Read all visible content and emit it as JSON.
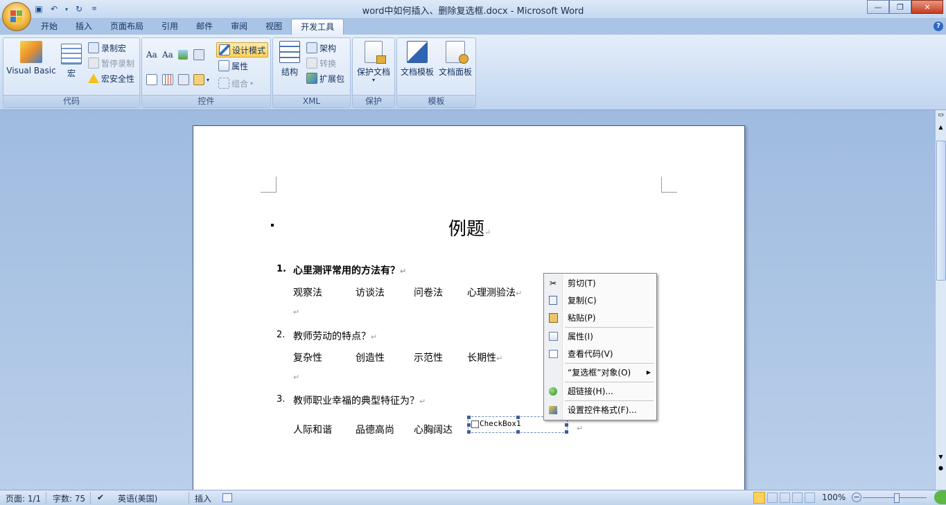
{
  "window": {
    "title": "word中如何插入、删除复选框.docx - Microsoft Word"
  },
  "tabs": [
    "开始",
    "插入",
    "页面布局",
    "引用",
    "邮件",
    "审阅",
    "视图",
    "开发工具"
  ],
  "ribbon": {
    "code": {
      "caption": "代码",
      "visual_basic": "Visual Basic",
      "macro": "宏",
      "record_macro": "录制宏",
      "pause_record": "暂停录制",
      "macro_security": "宏安全性"
    },
    "controls": {
      "caption": "控件",
      "aa1": "Aa",
      "aa2": "Aa",
      "design_mode": "设计模式",
      "properties": "属性",
      "group": "组合"
    },
    "xml": {
      "caption": "XML",
      "structure": "结构",
      "schema": "架构",
      "transform": "转换",
      "expansion_pack": "扩展包"
    },
    "protect": {
      "caption": "保护",
      "protect_doc": "保护文档"
    },
    "templates": {
      "caption": "模板",
      "doc_template": "文档模板",
      "doc_panel": "文档面板"
    }
  },
  "document": {
    "title": "例题",
    "questions": [
      {
        "num": "1.",
        "text": "心里测评常用的方法有？",
        "options": [
          "观察法",
          "访谈法",
          "问卷法",
          "心理测验法"
        ]
      },
      {
        "num": "2.",
        "text": "教师劳动的特点？",
        "options": [
          "复杂性",
          "创造性",
          "示范性",
          "长期性"
        ]
      },
      {
        "num": "3.",
        "text": "教师职业幸福的典型特征为？",
        "options": [
          "人际和谐",
          "品德高尚",
          "心胸阔达"
        ]
      }
    ],
    "checkbox_label": "CheckBox1",
    "para_mark": "↵"
  },
  "context_menu": {
    "cut": "剪切(T)",
    "copy": "复制(C)",
    "paste": "粘贴(P)",
    "properties": "属性(I)",
    "view_code": "查看代码(V)",
    "object": "“复选框”对象(O)",
    "hyperlink": "超链接(H)...",
    "format_control": "设置控件格式(F)..."
  },
  "status": {
    "page": "页面: 1/1",
    "words": "字数: 75",
    "language": "英语(美国)",
    "mode": "插入",
    "zoom": "100%"
  },
  "colors": {
    "accent": "#2e68c0",
    "active": "#ffd15a"
  }
}
